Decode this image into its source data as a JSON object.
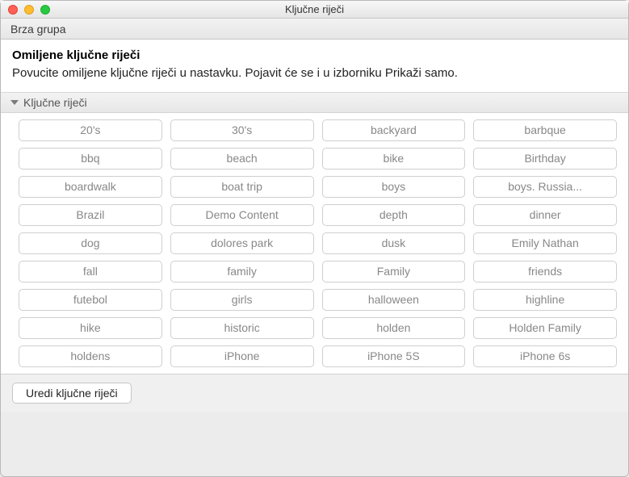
{
  "window": {
    "title": "Ključne riječi"
  },
  "toolbar": {
    "group_label": "Brza grupa"
  },
  "intro": {
    "title": "Omiljene ključne riječi",
    "description": "Povucite omiljene ključne riječi u nastavku. Pojavit će se i u izborniku Prikaži samo."
  },
  "section": {
    "header": "Ključne riječi"
  },
  "keywords": [
    "20's",
    "30's",
    "backyard",
    "barbque",
    "bbq",
    "beach",
    "bike",
    "Birthday",
    "boardwalk",
    "boat trip",
    "boys",
    "boys. Russia...",
    "Brazil",
    "Demo Content",
    "depth",
    "dinner",
    "dog",
    "dolores park",
    "dusk",
    "Emily Nathan",
    "fall",
    "family",
    "Family",
    "friends",
    "futebol",
    "girls",
    "halloween",
    "highline",
    "hike",
    "historic",
    "holden",
    "Holden Family",
    "holdens",
    "iPhone",
    "iPhone 5S",
    "iPhone 6s"
  ],
  "footer": {
    "edit_button": "Uredi ključne riječi"
  }
}
